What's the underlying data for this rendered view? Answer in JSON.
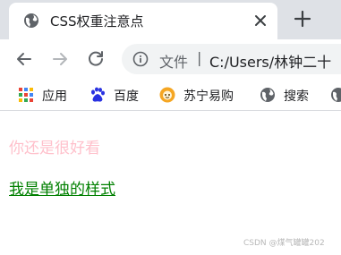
{
  "tab": {
    "title": "CSS权重注意点",
    "favicon": "globe-icon",
    "close_icon": "close-icon",
    "new_tab_icon": "plus-icon"
  },
  "toolbar": {
    "back_icon": "back-arrow-icon",
    "forward_icon": "forward-arrow-icon",
    "reload_icon": "reload-icon",
    "info_icon": "info-icon",
    "omnibox_label": "文件",
    "omnibox_separator": "|",
    "omnibox_url": "C:/Users/林钟二十"
  },
  "bookmarks": [
    {
      "label": "应用",
      "icon": "apps-grid-icon"
    },
    {
      "label": "百度",
      "icon": "baidu-paw-icon"
    },
    {
      "label": "苏宁易购",
      "icon": "suning-icon"
    },
    {
      "label": "搜索",
      "icon": "globe-icon"
    }
  ],
  "page": {
    "line1": "你还是很好看",
    "line2": "我是单独的样式",
    "line1_color": "#ffc0cb",
    "line2_color": "#008000"
  },
  "watermark": "CSDN @煤气罐罐202",
  "colors": {
    "tabstrip": "#dee1e6",
    "omnibox": "#f1f3f4"
  }
}
